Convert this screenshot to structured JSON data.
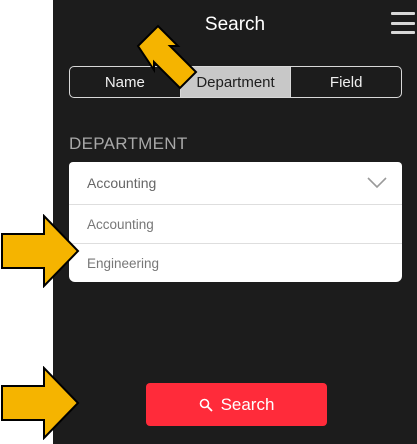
{
  "header": {
    "title": "Search"
  },
  "tabs": [
    {
      "label": "Name",
      "active": false
    },
    {
      "label": "Department",
      "active": true
    },
    {
      "label": "Field",
      "active": false
    }
  ],
  "department": {
    "section_label": "DEPARTMENT",
    "selected": "Accounting",
    "options": [
      "Accounting",
      "Engineering"
    ]
  },
  "search_button": {
    "label": "Search",
    "icon": "magnifier-icon"
  },
  "colors": {
    "screen_bg": "#1c1c1c",
    "accent": "#ff2b3a",
    "arrow": "#f5b400"
  },
  "icons": [
    "menu-icon",
    "chevron-down-icon",
    "magnifier-icon",
    "pointer-arrow-icon"
  ]
}
